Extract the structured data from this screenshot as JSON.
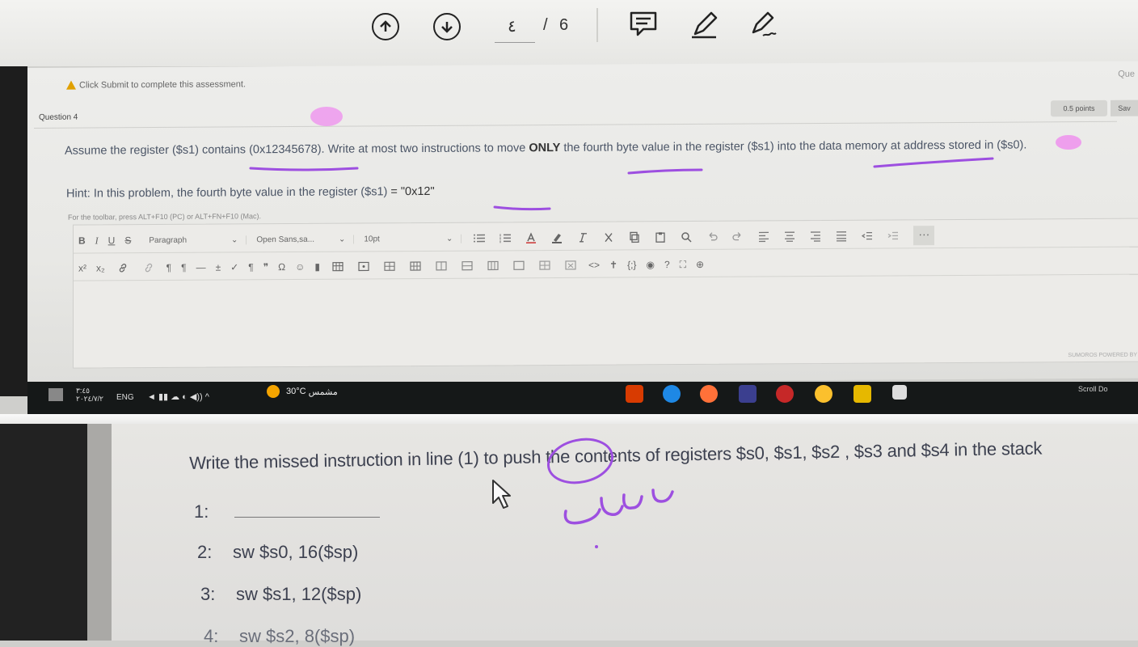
{
  "viewer": {
    "page_current": "٤",
    "page_separator": "/",
    "page_total": "6"
  },
  "lms": {
    "notice": "Click Submit to complete this assessment.",
    "topright_label": "Que",
    "question_label": "Question 4",
    "points": "0.5 points",
    "save_label": "Sav",
    "question_part1": "Assume the register ($s1) contains (0x12345678). Write at most two instructions to move ",
    "question_bold": "ONLY",
    "question_part2": " the fourth byte value in the register ($s1) into the data memory at address stored in ($s0).",
    "hint_label": "Hint: In this problem, the fourth byte value in the register ($s1)",
    "hint_value": "= \"0x12\"",
    "toolbar_help": "For the toolbar, press ALT+F10 (PC) or ALT+FN+F10 (Mac).",
    "toolbar": {
      "paragraph": "Paragraph",
      "font": "Open Sans,sa...",
      "size": "10pt",
      "more": "···"
    },
    "powered": "SUMOROS  POWERED BY"
  },
  "taskbar": {
    "time": "٣:٤٥",
    "date": "٢٠٢٤/٧/٢",
    "lang": "ENG",
    "weather_temp": "30°C",
    "weather_desc": "مشمس",
    "right_label": "Scroll Do"
  },
  "paper": {
    "prompt": "Write the missed instruction in line (1) to push the contents of registers $s0, $s1, $s2 , $s3 and $s4 in the stack",
    "lines": [
      {
        "num": "1:",
        "code": ""
      },
      {
        "num": "2:",
        "code": "sw   $s0, 16($sp)"
      },
      {
        "num": "3:",
        "code": "sw   $s1, 12($sp)"
      },
      {
        "num": "4:",
        "code": "sw   $s2, 8($sp)"
      }
    ]
  },
  "colors": {
    "annotation": "#9d4fe0",
    "highlight": "#f06cf0",
    "taskbar": "#151818"
  }
}
